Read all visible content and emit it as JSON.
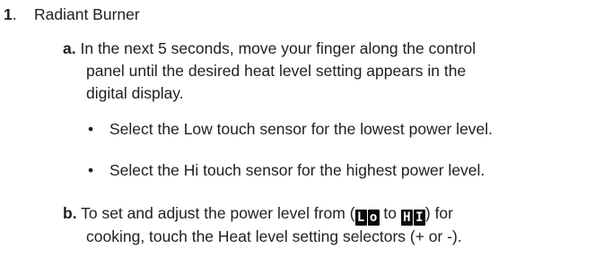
{
  "step": {
    "number": "1",
    "separator": ".",
    "title": "Radiant Burner"
  },
  "item_a": {
    "lead": "a.",
    "line1": "In the next 5 seconds, move your finger along the control",
    "line2": "panel until the desired heat level setting appears in the",
    "line3": "digital display."
  },
  "bullets": [
    "Select the Low touch sensor for the lowest power level.",
    "Select the Hi touch sensor for the highest power level."
  ],
  "item_b": {
    "lead": "b.",
    "text_before": "To set and adjust the power level from (",
    "display_low": [
      "L",
      "o"
    ],
    "text_to": " to ",
    "display_high": [
      "H",
      "I"
    ],
    "text_after": ") for",
    "line2": "cooking, touch the Heat level setting selectors (+ or -)."
  }
}
